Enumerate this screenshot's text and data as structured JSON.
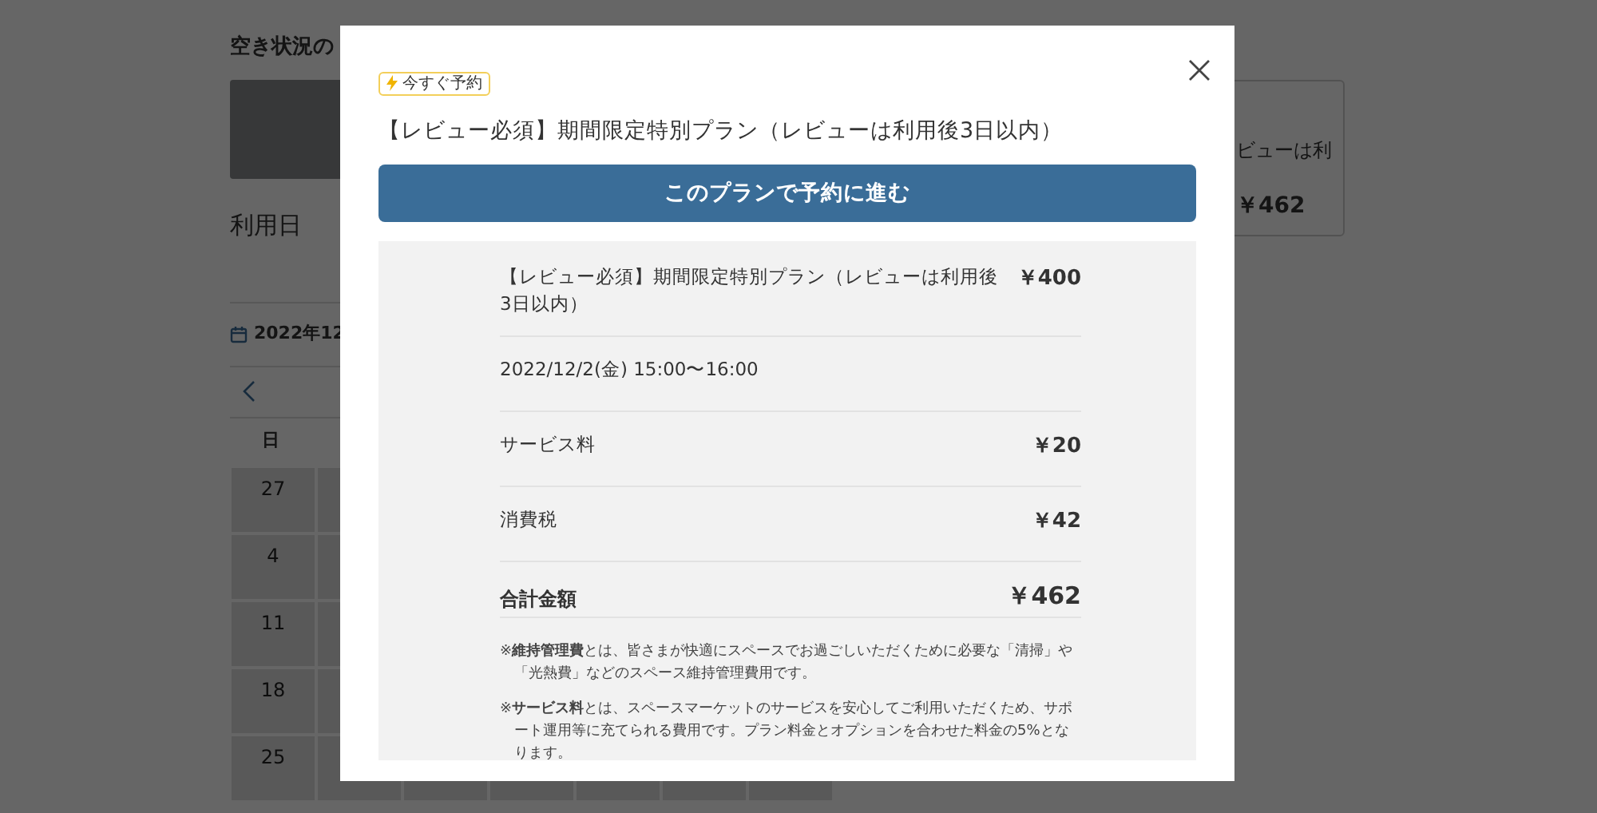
{
  "background": {
    "heading": "空き状況の",
    "date_label": "利用日",
    "calendar": {
      "month": "2022年12",
      "weekday": "日",
      "dates": [
        "27",
        "4",
        "11",
        "18",
        "25"
      ]
    },
    "summary_card": {
      "plan_snippet": "ビューは利",
      "total": "￥462"
    }
  },
  "modal": {
    "badge": "今すぐ予約",
    "plan_title": "【レビュー必須】期間限定特別プラン（レビューは利用後3日以内）",
    "book_button": "このプランで予約に進む",
    "breakdown": [
      {
        "kind": "line",
        "label": "【レビュー必須】期間限定特別プラン（レビューは利用後3日以内）",
        "amount": "￥400"
      },
      {
        "kind": "line",
        "label": "2022/12/2(金) 15:00〜16:00"
      },
      {
        "kind": "line",
        "label": "サービス料",
        "amount": "￥20"
      },
      {
        "kind": "line",
        "label": "消費税",
        "amount": "￥42"
      },
      {
        "kind": "total",
        "label": "合計金額",
        "amount": "￥462"
      }
    ],
    "notes": [
      "※**維持管理費**とは、皆さまが快適にスペースでお過ごしいただくために必要な「清掃」や「光熱費」などのスペース維持管理費用です。",
      "※**サービス料**とは、スペースマーケットのサービスを安心してご利用いただくため、サポート運用等に充てられる費用です。プラン料金とオプションを合わせた料金の5%となります。"
    ]
  }
}
